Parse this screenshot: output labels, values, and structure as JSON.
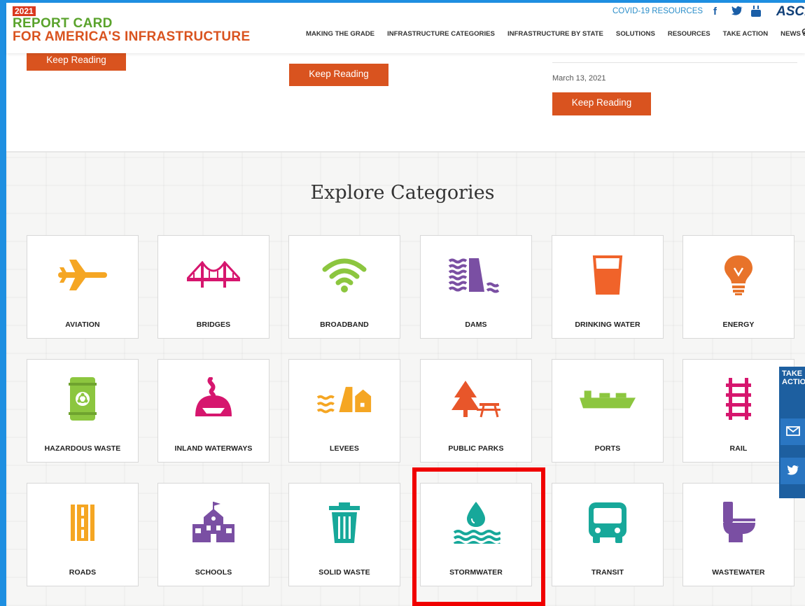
{
  "header": {
    "year": "2021",
    "logo_line1": "REPORT CARD",
    "logo_line2": "FOR AMERICA'S INFRASTRUCTURE",
    "covid_link": "COVID-19 RESOURCES",
    "brand": "ASCE",
    "nav": [
      "MAKING THE GRADE",
      "INFRASTRUCTURE CATEGORIES",
      "INFRASTRUCTURE BY STATE",
      "SOLUTIONS",
      "RESOURCES",
      "TAKE ACTION",
      "NEWS & INSIGHTS"
    ]
  },
  "top": {
    "keep_reading": "Keep Reading",
    "date": "March 13, 2021"
  },
  "explore": {
    "title": "Explore Categories",
    "categories": [
      "AVIATION",
      "BRIDGES",
      "BROADBAND",
      "DAMS",
      "DRINKING WATER",
      "ENERGY",
      "HAZARDOUS WASTE",
      "INLAND WATERWAYS",
      "LEVEES",
      "PUBLIC PARKS",
      "PORTS",
      "RAIL",
      "ROADS",
      "SCHOOLS",
      "SOLID WASTE",
      "STORMWATER",
      "TRANSIT",
      "WASTEWATER"
    ]
  },
  "side": {
    "take_action": "TAKE ACTION"
  },
  "colors": {
    "orange": "#d9531f",
    "green": "#5aa32c",
    "frame_blue": "#1e8fe1"
  }
}
